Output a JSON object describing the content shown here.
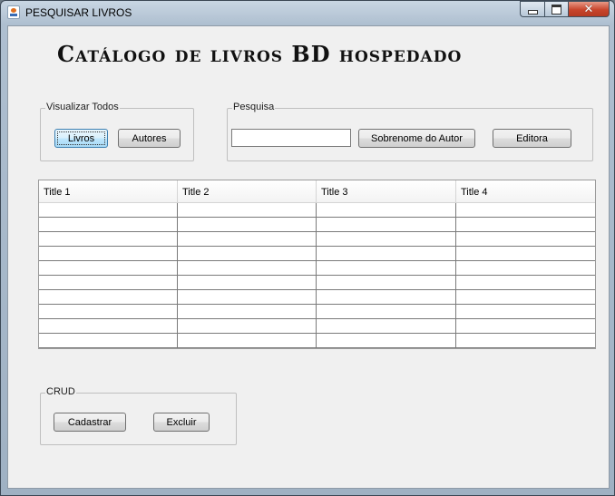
{
  "window": {
    "title": "PESQUISAR LIVROS",
    "minimize_label": "Minimize",
    "maximize_label": "Maximize",
    "close_label": "Close"
  },
  "heading": "Catálogo de livros BD hospedado",
  "visualizar": {
    "legend": "Visualizar Todos",
    "livros_label": "Livros",
    "autores_label": "Autores"
  },
  "pesquisa": {
    "legend": "Pesquisa",
    "search_value": "",
    "sobrenome_label": "Sobrenome do Autor",
    "editora_label": "Editora"
  },
  "table": {
    "columns": [
      "Title 1",
      "Title 2",
      "Title 3",
      "Title 4"
    ],
    "rows": [
      [
        "",
        "",
        "",
        ""
      ],
      [
        "",
        "",
        "",
        ""
      ],
      [
        "",
        "",
        "",
        ""
      ],
      [
        "",
        "",
        "",
        ""
      ],
      [
        "",
        "",
        "",
        ""
      ],
      [
        "",
        "",
        "",
        ""
      ],
      [
        "",
        "",
        "",
        ""
      ],
      [
        "",
        "",
        "",
        ""
      ],
      [
        "",
        "",
        "",
        ""
      ],
      [
        "",
        "",
        "",
        ""
      ]
    ]
  },
  "crud": {
    "legend": "CRUD",
    "cadastrar_label": "Cadastrar",
    "excluir_label": "Excluir"
  }
}
